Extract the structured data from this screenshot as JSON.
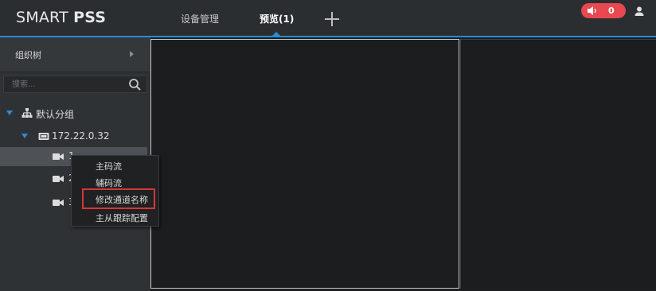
{
  "app": {
    "title_light": "SMART ",
    "title_bold": "PSS"
  },
  "tabs": [
    {
      "label": "设备管理"
    },
    {
      "label": "预览(1)"
    }
  ],
  "alarm": {
    "count": "0",
    "color": "#e8484f"
  },
  "accent_color": "#2a8cd6",
  "sidebar": {
    "header_label": "组织树",
    "search_placeholder": "搜索...",
    "tree": {
      "group_label": "默认分组",
      "device_label": "172.22.0.32",
      "channels": [
        {
          "label": "1"
        },
        {
          "label": "2"
        },
        {
          "label": "3"
        }
      ]
    }
  },
  "context_menu": {
    "items": [
      {
        "label": "主码流"
      },
      {
        "label": "辅码流"
      },
      {
        "label": "修改通道名称"
      },
      {
        "label": "主从跟踪配置"
      }
    ],
    "highlight_color": "#d6363a"
  },
  "icons": {
    "add_tab": "plus-icon",
    "alarm": "speaker-icon",
    "user": "user-icon",
    "search": "search-icon",
    "group": "org-tree-icon",
    "device": "nvr-icon",
    "channel": "camera-icon"
  }
}
